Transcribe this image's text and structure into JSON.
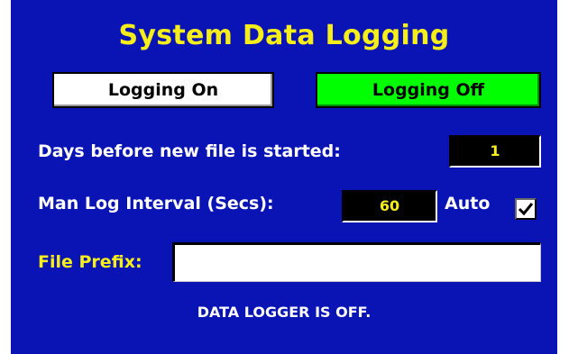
{
  "title": "System Data Logging",
  "buttons": {
    "logging_on": "Logging On",
    "logging_off": "Logging Off"
  },
  "days_before_new_file": {
    "label": "Days before new file is started:",
    "value": "1"
  },
  "man_log_interval": {
    "label": "Man Log Interval (Secs):",
    "value": "60"
  },
  "auto": {
    "label": "Auto",
    "checked": true
  },
  "file_prefix": {
    "label": "File Prefix:",
    "value": ""
  },
  "status": "DATA LOGGER IS OFF.",
  "colors": {
    "panel_background": "#0a14b4",
    "title_yellow": "#f5ee1a",
    "logging_off_active": "#00ff00",
    "value_box": "#000000"
  },
  "icons": {
    "auto_checkbox": "checkmark-icon"
  }
}
